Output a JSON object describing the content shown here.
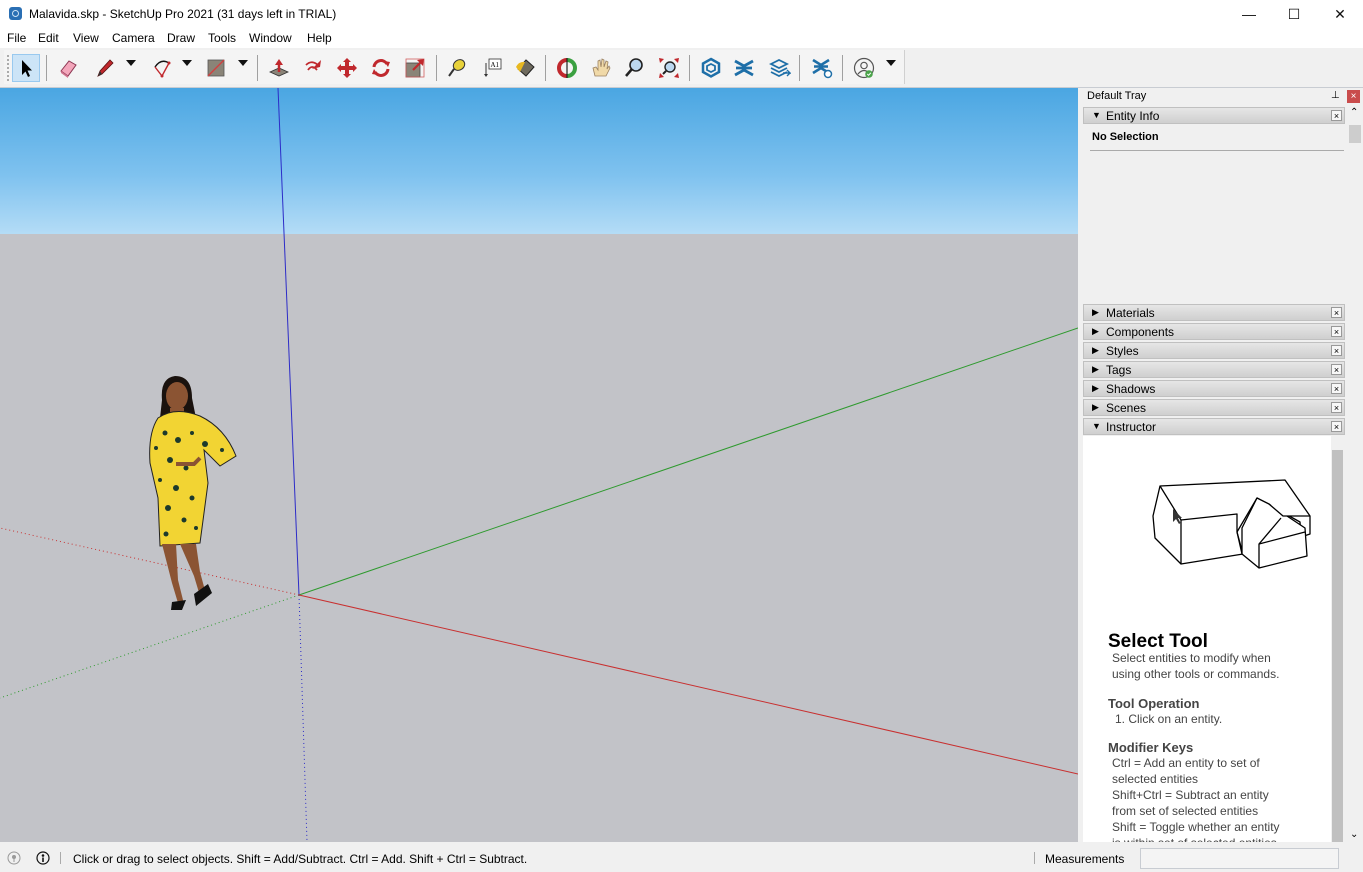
{
  "window": {
    "title": "Malavida.skp - SketchUp Pro 2021 (31 days left in TRIAL)",
    "minimize": "—",
    "maximize": "☐",
    "close": "✕"
  },
  "menu": [
    "File",
    "Edit",
    "View",
    "Camera",
    "Draw",
    "Tools",
    "Window",
    "Help"
  ],
  "toolbar": {
    "tools": [
      {
        "name": "select-tool",
        "active": true
      },
      {
        "name": "eraser-tool"
      },
      {
        "name": "line-tool",
        "dropdown": true
      },
      {
        "name": "arc-tool",
        "dropdown": true
      },
      {
        "name": "rectangle-tool",
        "dropdown": true
      },
      {
        "name": "push-pull-tool"
      },
      {
        "name": "offset-tool"
      },
      {
        "name": "move-tool"
      },
      {
        "name": "rotate-tool"
      },
      {
        "name": "scale-tool"
      },
      {
        "name": "tape-measure-tool"
      },
      {
        "name": "text-tool",
        "glyph": "A1"
      },
      {
        "name": "paint-bucket-tool"
      },
      {
        "name": "orbit-tool"
      },
      {
        "name": "pan-tool"
      },
      {
        "name": "zoom-tool"
      },
      {
        "name": "zoom-extents-tool"
      },
      {
        "name": "3d-warehouse-tool"
      },
      {
        "name": "extension-warehouse-tool"
      },
      {
        "name": "send-to-layout-tool"
      },
      {
        "name": "extension-manager-tool"
      },
      {
        "name": "account-tool",
        "dropdown": true
      }
    ]
  },
  "tray": {
    "title": "Default Tray",
    "pin": "⊥",
    "close": "×",
    "entity_info": {
      "label": "Entity Info",
      "expanded": true,
      "content": "No Selection"
    },
    "panels": [
      {
        "label": "Materials",
        "expanded": false
      },
      {
        "label": "Components",
        "expanded": false
      },
      {
        "label": "Styles",
        "expanded": false
      },
      {
        "label": "Tags",
        "expanded": false
      },
      {
        "label": "Shadows",
        "expanded": false
      },
      {
        "label": "Scenes",
        "expanded": false
      },
      {
        "label": "Instructor",
        "expanded": true
      }
    ],
    "instructor": {
      "title": "Select Tool",
      "description": [
        "Select entities to modify when",
        "using other tools or commands."
      ],
      "operation_heading": "Tool Operation",
      "operation_steps": [
        "1. Click on an entity."
      ],
      "modifier_heading": "Modifier Keys",
      "modifier_lines": [
        "Ctrl = Add an entity to set of",
        "selected entities",
        "Shift+Ctrl = Subtract an entity",
        "from set of selected entities",
        "Shift = Toggle whether an entity",
        "is within set of selected entities"
      ]
    }
  },
  "status": {
    "hint": "Click or drag to select objects. Shift = Add/Subtract. Ctrl = Add. Shift + Ctrl = Subtract.",
    "measurements_label": "Measurements",
    "measurements_value": ""
  },
  "colors": {
    "sky_top": "#4aa6e2",
    "ground": "#c2c3c8",
    "axis_red": "#d03030",
    "axis_green": "#30a030",
    "axis_blue": "#2020c0"
  }
}
